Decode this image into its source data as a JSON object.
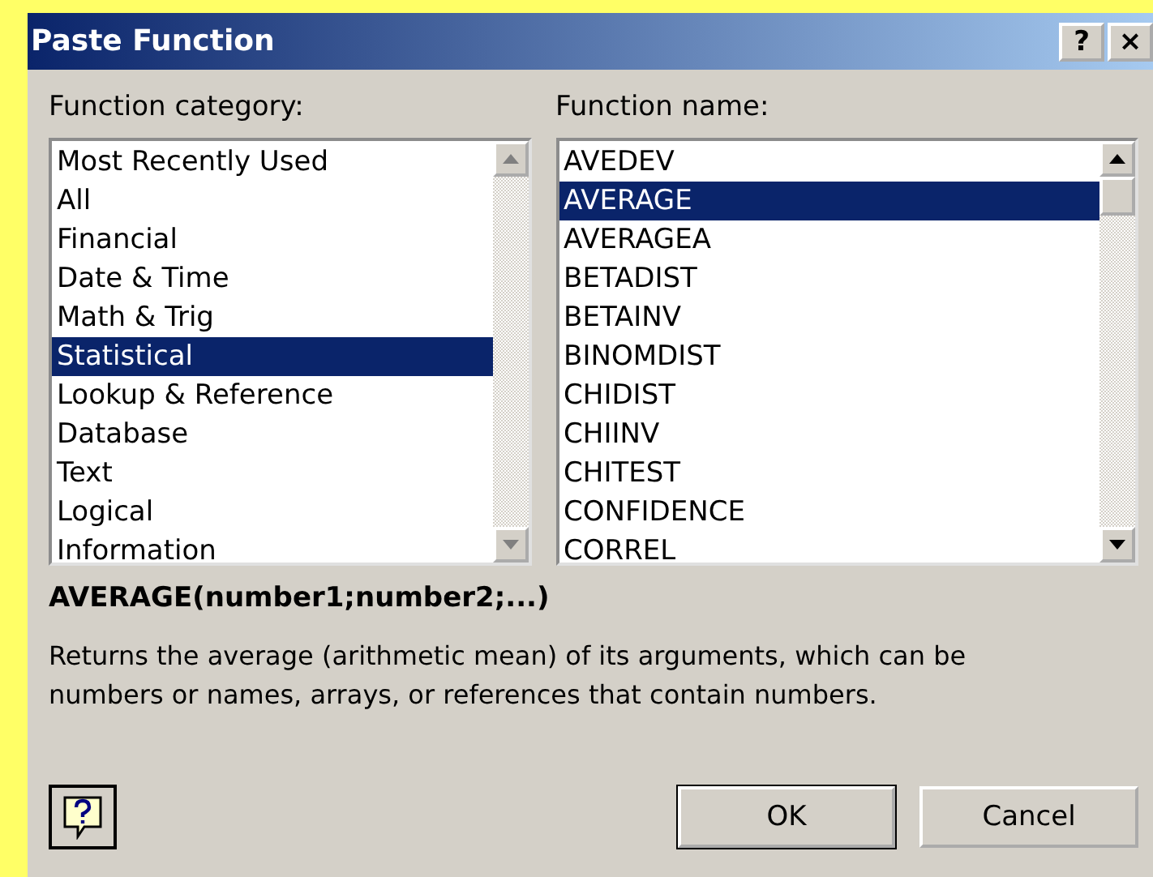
{
  "window": {
    "title": "Paste Function",
    "title_buttons": [
      "?",
      "×"
    ]
  },
  "category_list": {
    "label": "Function category:",
    "scroll_disabled": true,
    "items": [
      {
        "label": "Most Recently Used",
        "selected": false
      },
      {
        "label": "All",
        "selected": false
      },
      {
        "label": "Financial",
        "selected": false
      },
      {
        "label": "Date & Time",
        "selected": false
      },
      {
        "label": "Math & Trig",
        "selected": false
      },
      {
        "label": "Statistical",
        "selected": true
      },
      {
        "label": "Lookup & Reference",
        "selected": false
      },
      {
        "label": "Database",
        "selected": false
      },
      {
        "label": "Text",
        "selected": false
      },
      {
        "label": "Logical",
        "selected": false
      },
      {
        "label": "Information",
        "selected": false
      }
    ]
  },
  "name_list": {
    "label": "Function name:",
    "scroll_disabled": false,
    "items": [
      {
        "label": "AVEDEV",
        "selected": false
      },
      {
        "label": "AVERAGE",
        "selected": true
      },
      {
        "label": "AVERAGEA",
        "selected": false
      },
      {
        "label": "BETADIST",
        "selected": false
      },
      {
        "label": "BETAINV",
        "selected": false
      },
      {
        "label": "BINOMDIST",
        "selected": false
      },
      {
        "label": "CHIDIST",
        "selected": false
      },
      {
        "label": "CHIINV",
        "selected": false
      },
      {
        "label": "CHITEST",
        "selected": false
      },
      {
        "label": "CONFIDENCE",
        "selected": false
      },
      {
        "label": "CORREL",
        "selected": false
      }
    ]
  },
  "syntax": "AVERAGE(number1;number2;...)",
  "description": "Returns the average (arithmetic mean) of its arguments, which can be numbers or names, arrays, or references that contain numbers.",
  "buttons": [
    "OK",
    "Cancel"
  ]
}
